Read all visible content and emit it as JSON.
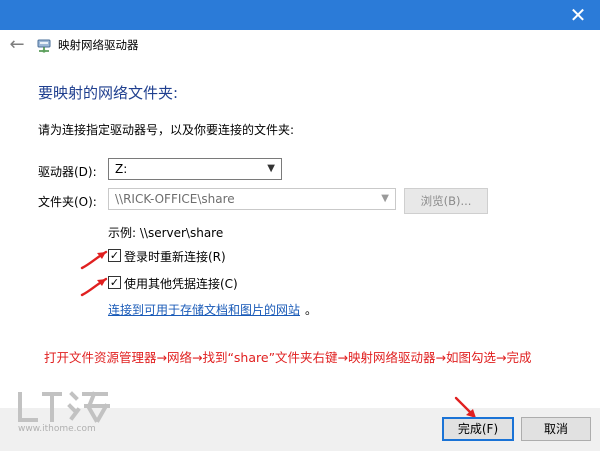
{
  "window": {
    "close_glyph": "✕",
    "back_glyph": "←",
    "title": "映射网络驱动器"
  },
  "main": {
    "heading": "要映射的网络文件夹:",
    "instruction": "请为连接指定驱动器号，以及你要连接的文件夹:",
    "drive": {
      "label": "驱动器(D):",
      "value": "Z:"
    },
    "folder": {
      "label": "文件夹(O):",
      "value": "\\\\RICK-OFFICE\\share",
      "browse_label": "浏览(B)..."
    },
    "example": "示例: \\\\server\\share",
    "reconnect": {
      "checked": true,
      "label": "登录时重新连接(R)"
    },
    "other_credentials": {
      "checked": true,
      "label": "使用其他凭据连接(C)"
    },
    "link_text": "连接到可用于存储文档和图片的网站",
    "link_suffix": "。"
  },
  "annotation": "打开文件资源管理器→网络→找到“share”文件夹右键→映射网络驱动器→如图勾选→完成",
  "footer": {
    "finish_label": "完成(F)",
    "cancel_label": "取消"
  },
  "watermark": {
    "site": "www.ithome.com"
  },
  "colors": {
    "titlebar": "#2b7bd8",
    "heading": "#1f3f8f",
    "link": "#1a5bb8",
    "annotation": "#e02020",
    "primary_border": "#1a73d6"
  },
  "icons": {
    "close": "close-icon",
    "back": "back-arrow-icon",
    "network_drive": "network-drive-icon",
    "dropdown": "chevron-down-icon",
    "check": "checkmark-icon",
    "pointer_arrow": "red-arrow-icon"
  }
}
